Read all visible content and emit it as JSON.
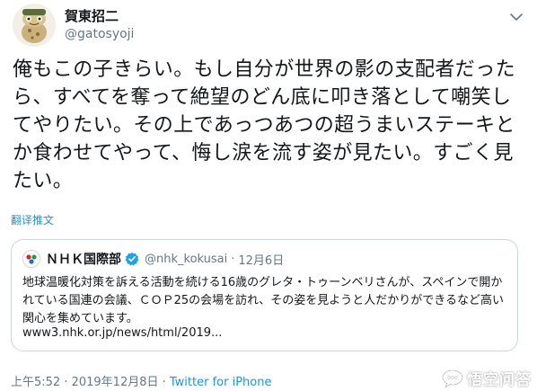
{
  "author": {
    "display_name": "賀東招二",
    "handle": "@gatosyoji"
  },
  "tweet": {
    "text": "俺もこの子きらい。もし自分が世界の影の支配者だったら、すべてを奪って絶望のどん底に叩き落として嘲笑してやりたい。その上であっつあつの超うまいステーキとか食わせてやって、悔し涙を流す姿が見たい。すごく見たい。",
    "translate_label": "翻译推文"
  },
  "quoted": {
    "name": "ＮＨＫ国際部",
    "handle": "@nhk_kokusai",
    "separator": "·",
    "date": "12月6日",
    "text": "地球温暖化対策を訴える活動を続ける16歳のグレタ・トゥーンベリさんが、スペインで開かれている国連の会議、ＣＯＰ25の会場を訪れ、その姿を見ようと人だかりができるなど高い関心を集めています。",
    "link": "www3.nhk.or.jp/news/html/2019..."
  },
  "meta": {
    "timestamp": "上午5:52 · 2019年12月8日 · ",
    "via": "Twitter for iPhone"
  },
  "watermark": {
    "text": "悟空问答"
  },
  "colors": {
    "link_blue": "#1b95e0",
    "secondary_text": "#657786",
    "border": "#ccd6dd",
    "verified_blue": "#1da1f2"
  },
  "icons": {
    "avatar": "frog-cartoon-avatar",
    "caret": "chevron-down-icon",
    "verified": "verified-badge-icon",
    "nhk_logo": "nhk-logo-icon"
  }
}
